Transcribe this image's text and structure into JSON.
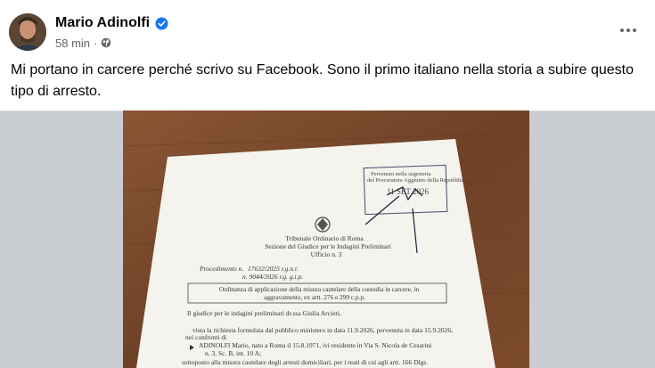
{
  "post": {
    "author": "Mario Adinolfi",
    "timestamp": "58 min",
    "separator": "·",
    "audience_icon": "globe-icon",
    "verified_icon": "verified-badge-icon",
    "more_icon": "more-options-icon",
    "text": "Mi portano in carcere perché scrivo su Facebook. Sono il primo italiano nella storia a subire questo tipo di arresto."
  },
  "document": {
    "stamp": [
      "Pervenuto nella segreteria",
      "del Procuratore Aggiunto della Repubblica",
      "11 SET 2026"
    ],
    "header": [
      "Tribunale Ordinario di Roma",
      "Sezione del Giudice per le Indagini Preliminari",
      "Ufficio n. 3"
    ],
    "proc1_label": "Procedimento n.",
    "proc1_value": "17632/2025 r.g.n.r.",
    "proc2_value": "n. 9044/2026 r.g. g.i.p.",
    "box_title": [
      "Ordinanza di applicazione della misura cautelare della custodia in carcere, in",
      "aggravamento, ex artt. 276 e 299 c.p.p."
    ],
    "body": [
      "Il giudice per le indagini preliminari dr.ssa Giulia Arcieri,",
      "vista la richiesta formulata dal pubblico ministero in data 11.9.2026, pervenuta in data 15.9.2026,",
      "nei confronti di",
      "ADINOLFI Mario, nato a Roma il 15.8.1971, ivi residente in Via S. Nicola de Cesarini",
      "n. 3, Sc. B, int. 10 A;",
      "sottoposto alla misura cautelare degli arresti domiciliari, per i reati di cui agli artt. 166 Dlgs."
    ]
  },
  "colors": {
    "verified": "#1877f2",
    "meta": "#65676b",
    "text": "#050505",
    "table_wood": "#7a4a2c"
  }
}
